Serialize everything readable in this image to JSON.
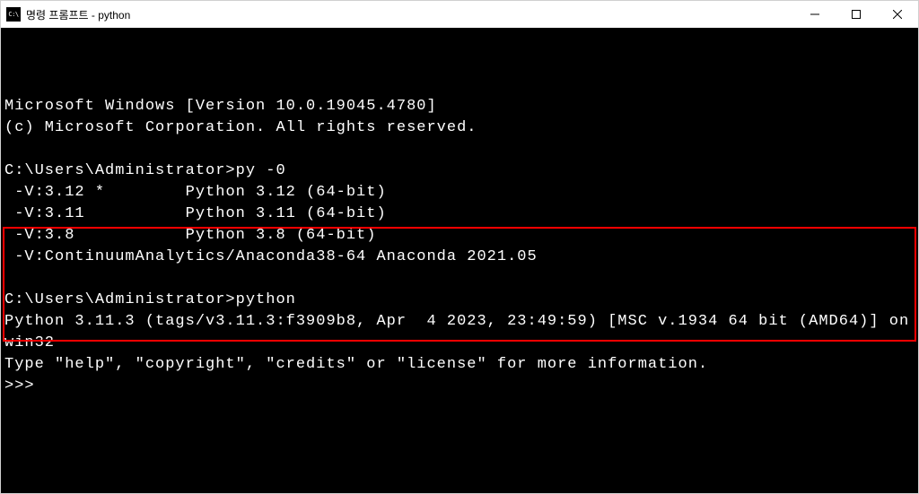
{
  "window": {
    "title": "명령 프롬프트 - python"
  },
  "terminal": {
    "line_ms1": "Microsoft Windows [Version 10.0.19045.4780]",
    "line_ms2": "(c) Microsoft Corporation. All rights reserved.",
    "blank1": "",
    "prompt1_path": "C:\\Users\\Administrator>",
    "prompt1_cmd": "py -0",
    "py_list_1": " -V:3.12 *        Python 3.12 (64-bit)",
    "py_list_2": " -V:3.11          Python 3.11 (64-bit)",
    "py_list_3": " -V:3.8           Python 3.8 (64-bit)",
    "py_list_4": " -V:ContinuumAnalytics/Anaconda38-64 Anaconda 2021.05",
    "blank2": "",
    "prompt2_path": "C:\\Users\\Administrator>",
    "prompt2_cmd": "python",
    "py_banner1": "Python 3.11.3 (tags/v3.11.3:f3909b8, Apr  4 2023, 23:49:59) [MSC v.1934 64 bit (AMD64)] on win32",
    "py_banner2": "Type \"help\", \"copyright\", \"credits\" or \"license\" for more information.",
    "py_prompt": ">>> "
  }
}
